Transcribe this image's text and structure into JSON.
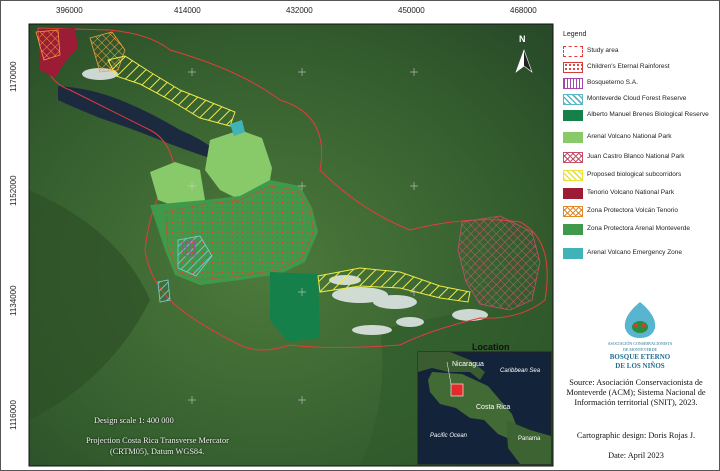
{
  "axes": {
    "x_ticks": [
      "396000",
      "414000",
      "432000",
      "450000",
      "468000"
    ],
    "y_ticks": [
      "1170000",
      "1152000",
      "1134000",
      "1116000"
    ]
  },
  "north_arrow": {
    "label": "N",
    "icon": "north-arrow-icon"
  },
  "legend": {
    "title": "Legend",
    "items": [
      {
        "label": "Study area",
        "fill": "none",
        "stroke": "#e23c3c",
        "pattern": "dashed-outline"
      },
      {
        "label": "Children's Eternal Rainforest",
        "fill": "#ffffff",
        "stroke": "#d93b3b",
        "pattern": "dots"
      },
      {
        "label": "Bosqueterno S.A.",
        "fill": "#ffffff",
        "stroke": "#a347a8",
        "pattern": "vertical-lines"
      },
      {
        "label": "Monteverde Cloud Forest Reserve",
        "fill": "#ffffff",
        "stroke": "#5ab7c4",
        "pattern": "diagonal-lines"
      },
      {
        "label": "Alberto Manuel Brenes Biological Reserve",
        "fill": "#16804a",
        "stroke": "#16804a",
        "pattern": "solid"
      },
      {
        "label": "Arenal Volcano National Park",
        "fill": "#88c96a",
        "stroke": "#88c96a",
        "pattern": "solid"
      },
      {
        "label": "Juan Castro Blanco National Park",
        "fill": "#ffffff",
        "stroke": "#c4506a",
        "pattern": "crosshatch"
      },
      {
        "label": "Proposed biological subcorridors",
        "fill": "#ffffff",
        "stroke": "#e8e23a",
        "pattern": "diagonal-lines"
      },
      {
        "label": "Tenorio Volcano National Park",
        "fill": "#9b1c34",
        "stroke": "#9b1c34",
        "pattern": "solid"
      },
      {
        "label": "Zona Protectora Volcán Tenorio",
        "fill": "#ffffff",
        "stroke": "#e08a2c",
        "pattern": "crosshatch"
      },
      {
        "label": "Zona Protectora Arenal Monteverde",
        "fill": "#3e9a4a",
        "stroke": "#3e9a4a",
        "pattern": "solid"
      },
      {
        "label": "Arenal Volcano Emergency Zone",
        "fill": "#3fb3b8",
        "stroke": "#3fb3b8",
        "pattern": "solid"
      }
    ]
  },
  "inset": {
    "title": "Location",
    "labels": {
      "nicaragua": "Nicaragua",
      "caribbean": "Caribbean Sea",
      "costa_rica": "Costa Rica",
      "pacific": "Pacific Ocean",
      "panama": "Panama"
    }
  },
  "scale": {
    "design_scale": "Design scale 1: 400 000",
    "projection": "Projection Costa Rica Transverse Mercator",
    "datum": "(CRTM05), Datum WGS84."
  },
  "logo": {
    "line1": "ASOCIACIÓN CONSERVACIONISTA",
    "line2": "DE MONTEVERDE",
    "line3": "BOSQUE ETERNO",
    "line4": "DE LOS NIÑOS"
  },
  "credits": {
    "source": "Source: Asociación Conservacionista de Monteverde (ACM); Sistema Nacional de Información territorial (SNIT), 2023.",
    "design": "Cartographic design: Doris Rojas J.",
    "date": "Date: April 2023"
  },
  "colors": {
    "frame_border": "#111111",
    "study_area": "#e23c3c",
    "lake": "#1c2a3f",
    "forest": "#355e2e"
  }
}
